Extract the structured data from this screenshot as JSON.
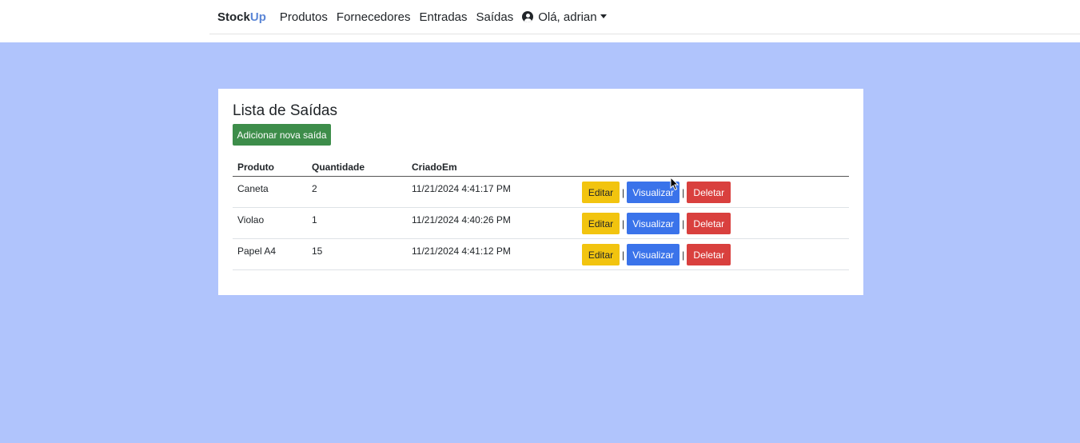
{
  "navbar": {
    "brand_part1": "Stock",
    "brand_part2": "Up",
    "links": [
      "Produtos",
      "Fornecedores",
      "Entradas",
      "Saídas"
    ],
    "user_greeting": "Olá, adrian",
    "user_icon": "user-circle-icon",
    "dropdown_icon": "caret-down-icon"
  },
  "page": {
    "title": "Lista de Saídas",
    "add_button": "Adicionar nova saída"
  },
  "table": {
    "headers": [
      "Produto",
      "Quantidade",
      "CriadoEm",
      ""
    ],
    "rows": [
      {
        "produto": "Caneta",
        "quantidade": "2",
        "criado_em": "11/21/2024 4:41:17 PM"
      },
      {
        "produto": "Violao",
        "quantidade": "1",
        "criado_em": "11/21/2024 4:40:26 PM"
      },
      {
        "produto": "Papel A4",
        "quantidade": "15",
        "criado_em": "11/21/2024 4:41:12 PM"
      }
    ],
    "actions": {
      "edit": "Editar",
      "view": "Visualizar",
      "delete": "Deletar",
      "separator": "|"
    }
  },
  "colors": {
    "background": "#b0c4fc",
    "add_button": "#3d8d4a",
    "edit_button": "#f2c40f",
    "view_button": "#3a73ea",
    "delete_button": "#d9403e",
    "brand_accent": "#5b86d6"
  }
}
